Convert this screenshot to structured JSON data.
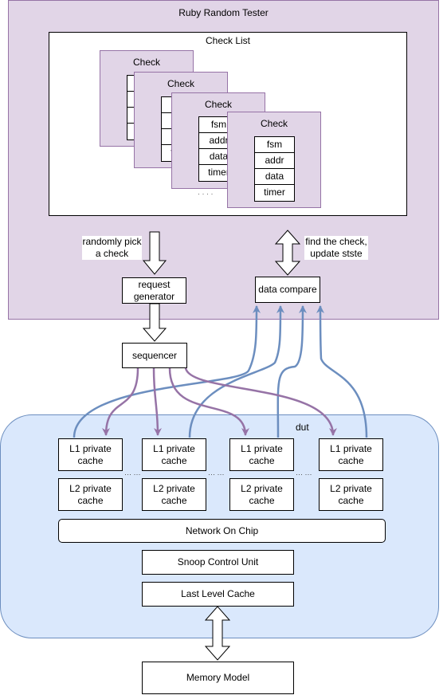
{
  "tester": {
    "title": "Ruby Random Tester"
  },
  "check_list": {
    "title": "Check List",
    "card_title": "Check",
    "fields": [
      "fsm",
      "addr",
      "data",
      "timer"
    ],
    "ellipsis": "· · · ·"
  },
  "labels": {
    "pick": "randomly pick a check",
    "find": "find the check, update stste"
  },
  "boxes": {
    "request_generator": "request generator",
    "data_compare": "data compare",
    "sequencer": "sequencer",
    "l1": "L1 private cache",
    "l2": "L2 private cache",
    "noc": "Network On Chip",
    "scu": "Snoop Control Unit",
    "llc": "Last Level Cache",
    "memory": "Memory Model"
  },
  "dut": {
    "title": "dut",
    "ellipsis": "··· ···"
  },
  "colors": {
    "tester_fill": "#e1d5e7",
    "tester_stroke": "#9673a6",
    "dut_fill": "#dae8fc",
    "dut_stroke": "#6c8ebf"
  }
}
